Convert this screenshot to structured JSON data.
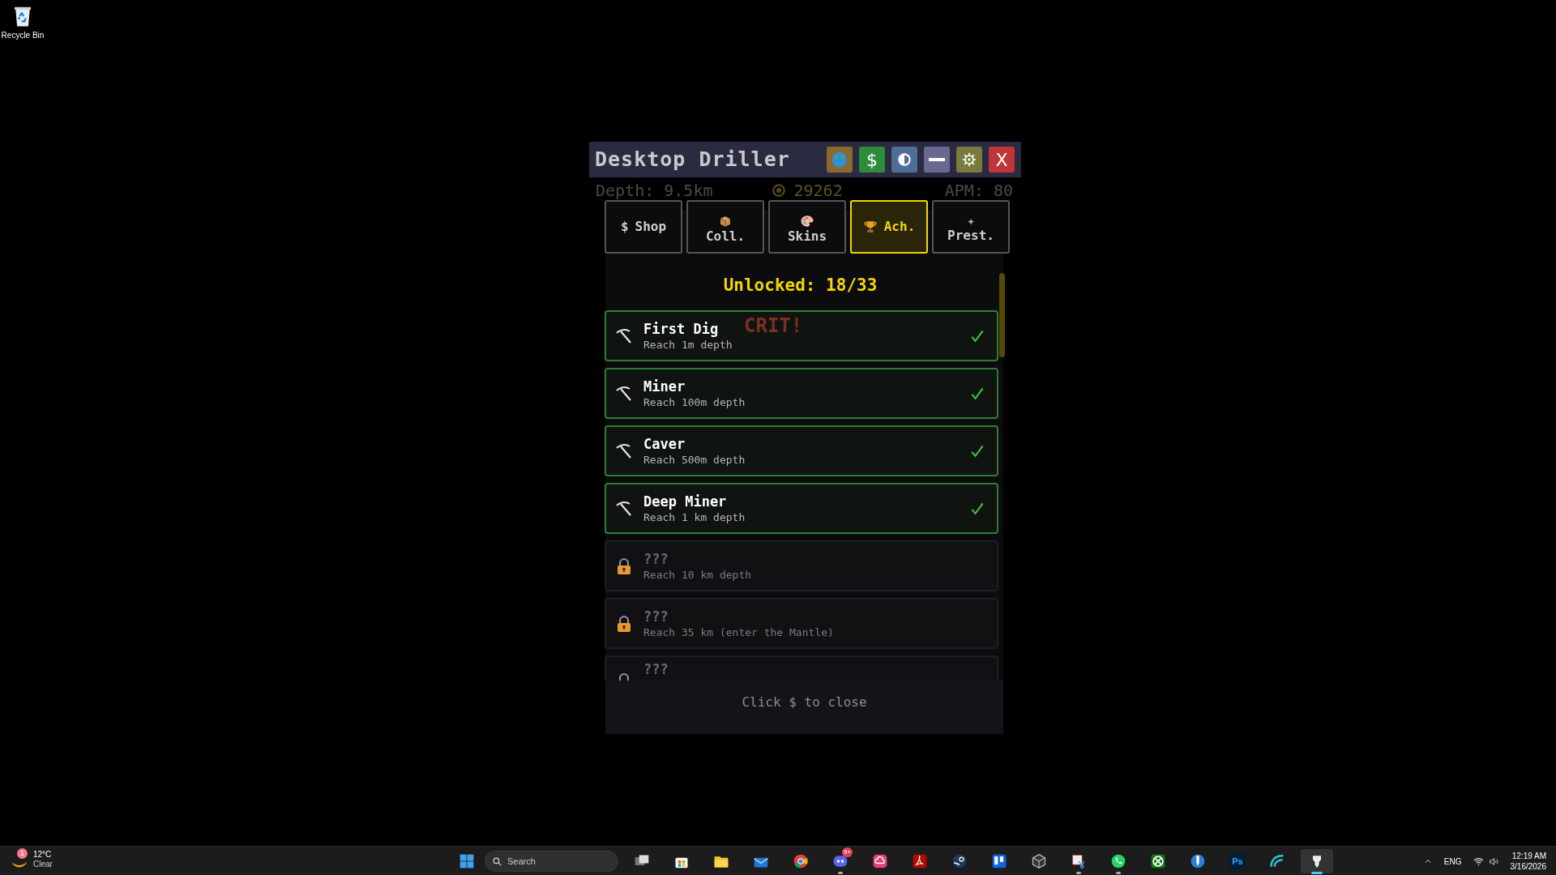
{
  "desktop": {
    "icons": [
      {
        "label": "Recycle Bin"
      }
    ]
  },
  "window": {
    "title": "Desktop Driller",
    "buttons": [
      {
        "kind": "globe",
        "color": "#8a6a2e"
      },
      {
        "kind": "glyph",
        "text": "$",
        "color": "#2e8b3a"
      },
      {
        "kind": "contrast",
        "color": "#4f6e96"
      },
      {
        "kind": "minimize",
        "color": "#6b6890"
      },
      {
        "kind": "settings",
        "color": "#7a7a3e"
      },
      {
        "kind": "glyph",
        "text": "X",
        "color": "#c0353a"
      }
    ]
  },
  "stats": {
    "depth": "Depth: 9.5km",
    "coins": "29262",
    "apm": "APM: 80"
  },
  "crit_popup": "CRIT!",
  "tabs": [
    {
      "label": "Shop",
      "icon": {
        "kind": "glyph",
        "text": "$"
      },
      "icon_above": false,
      "selected": false
    },
    {
      "label": "Coll.",
      "icon": {
        "kind": "box"
      },
      "icon_above": true,
      "selected": false
    },
    {
      "label": "Skins",
      "icon": {
        "kind": "palette"
      },
      "icon_above": true,
      "selected": false
    },
    {
      "label": "Ach.",
      "icon": {
        "kind": "trophy"
      },
      "icon_above": false,
      "selected": true
    },
    {
      "label": "Prest.",
      "icon": {
        "kind": "glyph",
        "text": "✦"
      },
      "icon_above": true,
      "selected": false
    }
  ],
  "achievements": {
    "summary": "Unlocked: 18/33",
    "items": [
      {
        "title": "First Dig",
        "description": "Reach 1m depth",
        "unlocked": true
      },
      {
        "title": "Miner",
        "description": "Reach 100m depth",
        "unlocked": true
      },
      {
        "title": "Caver",
        "description": "Reach 500m depth",
        "unlocked": true
      },
      {
        "title": "Deep Miner",
        "description": "Reach 1 km depth",
        "unlocked": true
      },
      {
        "title": "???",
        "description": "Reach 10 km depth",
        "unlocked": false
      },
      {
        "title": "???",
        "description": "Reach 35 km (enter the Mantle)",
        "unlocked": false
      },
      {
        "title": "???",
        "unlocked": false
      }
    ]
  },
  "footer": "Click $ to close",
  "taskbar": {
    "weather": {
      "badge": "1",
      "temperature": "12°C",
      "condition": "Clear"
    },
    "search": {
      "placeholder": "Search"
    },
    "apps": [
      {
        "kind": "taskview",
        "running": false
      },
      {
        "kind": "store",
        "running": false
      },
      {
        "kind": "folder",
        "running": false
      },
      {
        "kind": "mail",
        "running": false
      },
      {
        "kind": "browser",
        "running": false
      },
      {
        "kind": "chat",
        "running": true,
        "badge": "9+"
      },
      {
        "kind": "cloud",
        "running": false
      },
      {
        "kind": "pdf",
        "running": false
      },
      {
        "kind": "steam",
        "running": false
      },
      {
        "kind": "board",
        "running": false
      },
      {
        "kind": "cube",
        "running": false
      },
      {
        "kind": "snip",
        "running": true
      },
      {
        "kind": "phone",
        "running": true
      },
      {
        "kind": "xbox",
        "running": false
      },
      {
        "kind": "pen",
        "running": false
      },
      {
        "kind": "text",
        "text": "Ps",
        "running": false
      },
      {
        "kind": "wave",
        "running": false
      },
      {
        "kind": "drill",
        "running": true,
        "active": true
      }
    ],
    "tray": {
      "language": "ENG",
      "time": "12:19 AM",
      "date": "3/16/2026"
    }
  }
}
